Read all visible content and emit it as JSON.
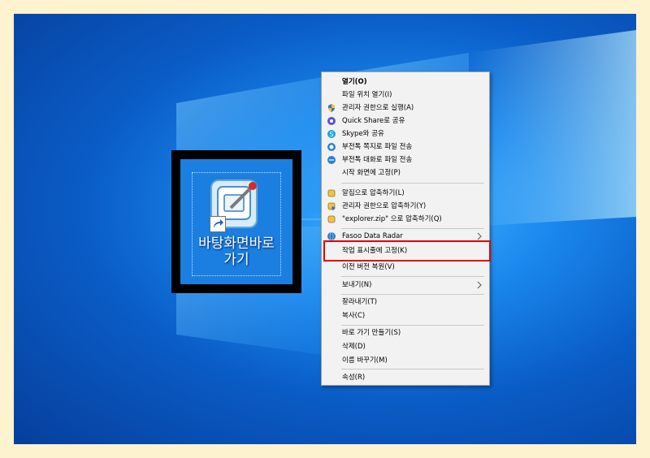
{
  "desktop_icon": {
    "label_line1": "바탕화면바로",
    "label_line2": "가기",
    "icon": "shortcut-icon"
  },
  "context_menu": {
    "items": [
      {
        "label": "열기(O)",
        "bold": true
      },
      {
        "label": "파일 위치 열기(I)"
      },
      {
        "label": "관리자 권한으로 실행(A)",
        "icon": "shield-icon"
      },
      {
        "label": "Quick Share로 공유",
        "icon": "quick-share-icon"
      },
      {
        "label": "Skype와 공유",
        "icon": "skype-icon"
      },
      {
        "label": "부전톡 쪽지로 파일 전송",
        "icon": "messenger-icon"
      },
      {
        "label": "부전톡 대화로 파일 전송",
        "icon": "chat-icon"
      },
      {
        "label": "시작 화면에 고정(P)"
      },
      {
        "label": "알집으로 압축하기(L)",
        "icon": "alzip-icon"
      },
      {
        "label": "관리자 권한으로 압축하기(Y)",
        "icon": "alzip-admin-icon"
      },
      {
        "label": "\"explorer.zip\" 으로 압축하기(Q)",
        "icon": "alzip-icon"
      },
      {
        "label": "Fasoo Data Radar",
        "icon": "globe-icon",
        "submenu": true
      },
      {
        "label": "작업 표시줄에 고정(K)",
        "highlighted": true
      },
      {
        "label": "이전 버전 복원(V)"
      },
      {
        "label": "보내기(N)",
        "submenu": true
      },
      {
        "label": "잘라내기(T)"
      },
      {
        "label": "복사(C)"
      },
      {
        "label": "바로 가기 만들기(S)"
      },
      {
        "label": "삭제(D)"
      },
      {
        "label": "이름 바꾸기(M)"
      },
      {
        "label": "속성(R)"
      }
    ]
  },
  "colors": {
    "frame": "#fdf3cf",
    "desktop": "#0a5cc6",
    "highlight_box": "#e60000",
    "menu_bg": "#f2f2f2"
  }
}
